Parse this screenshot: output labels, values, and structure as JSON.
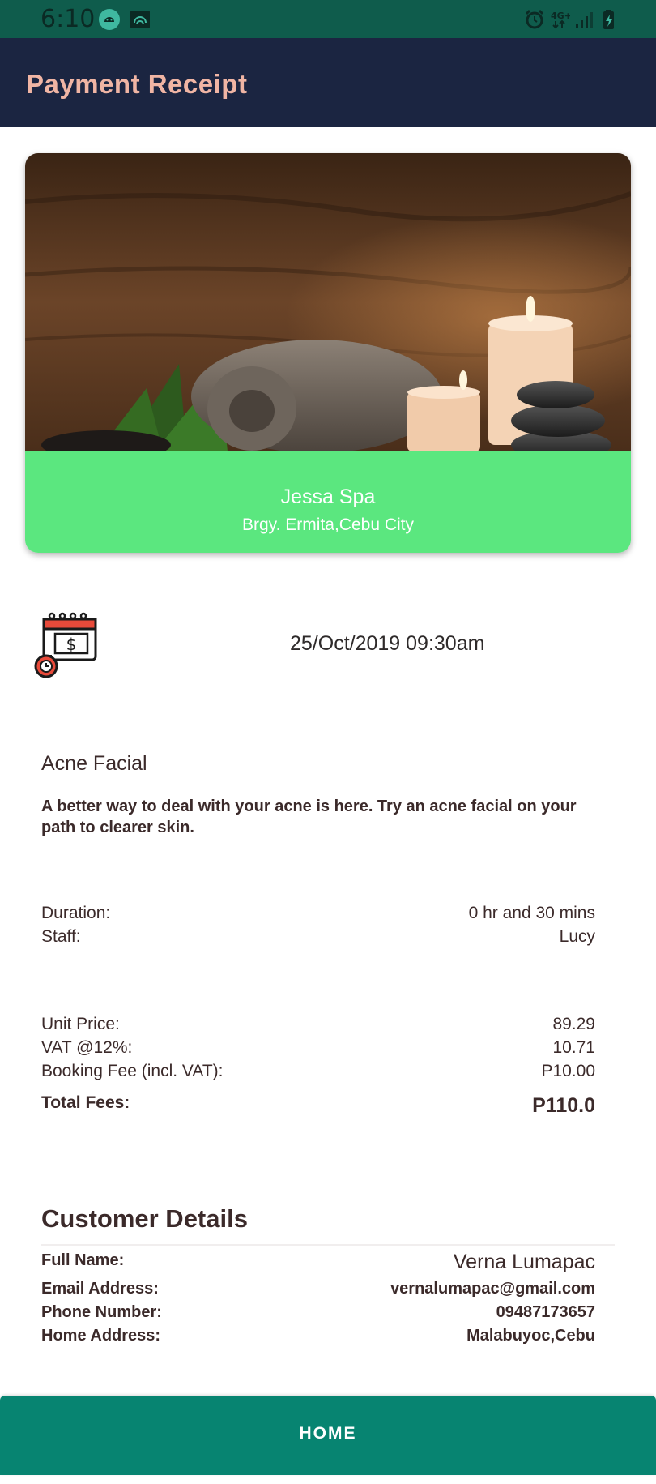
{
  "status_bar": {
    "time": "6:10",
    "left_icons": [
      "android-icon",
      "wifi-cast-icon"
    ],
    "right_icons": [
      "alarm-icon",
      "4g-icon",
      "signal-icon",
      "battery-charging-icon"
    ]
  },
  "app_bar": {
    "title": "Payment Receipt"
  },
  "spa": {
    "name": "Jessa Spa",
    "address": "Brgy. Ermita,Cebu City"
  },
  "booking": {
    "datetime": "25/Oct/2019 09:30am"
  },
  "service": {
    "name": "Acne Facial",
    "description": "A better way to deal with your acne is here. Try an acne facial on your path to clearer skin."
  },
  "details": {
    "duration_label": "Duration:",
    "duration_value": "0 hr and 30 mins",
    "staff_label": "Staff:",
    "staff_value": "Lucy"
  },
  "fees": {
    "unit_price_label": "Unit Price:",
    "unit_price_value": "89.29",
    "vat_label": "VAT @12%:",
    "vat_value": "10.71",
    "booking_fee_label": "Booking Fee (incl. VAT):",
    "booking_fee_value": "P10.00",
    "total_label": "Total Fees:",
    "total_value": "P110.0"
  },
  "customer": {
    "title": "Customer Details",
    "full_name_label": "Full Name:",
    "full_name_value": "Verna Lumapac",
    "email_label": "Email Address:",
    "email_value": "vernalumapac@gmail.com",
    "phone_label": "Phone Number:",
    "phone_value": "09487173657",
    "address_label": "Home Address:",
    "address_value": "Malabuyoc,Cebu"
  },
  "home_button": {
    "label": "HOME"
  },
  "colors": {
    "status_bar": "#0f5c4c",
    "app_bar": "#1b2541",
    "app_title": "#f0b5a4",
    "card_info": "#5be77f",
    "home_button": "#078471"
  }
}
